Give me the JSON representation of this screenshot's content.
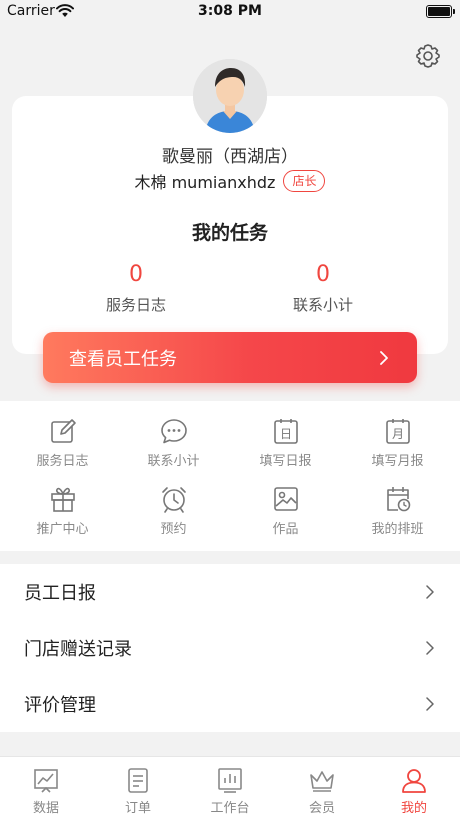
{
  "status_bar": {
    "carrier": "Carrier",
    "time": "3:08 PM"
  },
  "profile": {
    "store_name": "歌曼丽（西湖店）",
    "user_name": "木棉 mumianxhdz",
    "role": "店长"
  },
  "tasks": {
    "title": "我的任务",
    "stats": [
      {
        "value": "0",
        "label": "服务日志"
      },
      {
        "value": "0",
        "label": "联系小计"
      }
    ],
    "button_label": "查看员工任务"
  },
  "shortcuts": [
    {
      "label": "服务日志",
      "icon": "edit-icon"
    },
    {
      "label": "联系小计",
      "icon": "chat-icon"
    },
    {
      "label": "填写日报",
      "icon": "daily-report-icon",
      "glyph": "日"
    },
    {
      "label": "填写月报",
      "icon": "monthly-report-icon",
      "glyph": "月"
    },
    {
      "label": "推广中心",
      "icon": "gift-icon"
    },
    {
      "label": "预约",
      "icon": "alarm-clock-icon"
    },
    {
      "label": "作品",
      "icon": "image-icon"
    },
    {
      "label": "我的排班",
      "icon": "calendar-clock-icon"
    }
  ],
  "menu": [
    {
      "label": "员工日报"
    },
    {
      "label": "门店赠送记录"
    },
    {
      "label": "评价管理"
    }
  ],
  "tabbar": [
    {
      "label": "数据",
      "icon": "chart-icon"
    },
    {
      "label": "订单",
      "icon": "order-list-icon"
    },
    {
      "label": "工作台",
      "icon": "workbench-icon"
    },
    {
      "label": "会员",
      "icon": "crown-icon"
    },
    {
      "label": "我的",
      "icon": "user-icon",
      "active": true
    }
  ],
  "colors": {
    "accent": "#f0463f",
    "background": "#f2f2f2",
    "icon_gray": "#8a8a8a"
  }
}
